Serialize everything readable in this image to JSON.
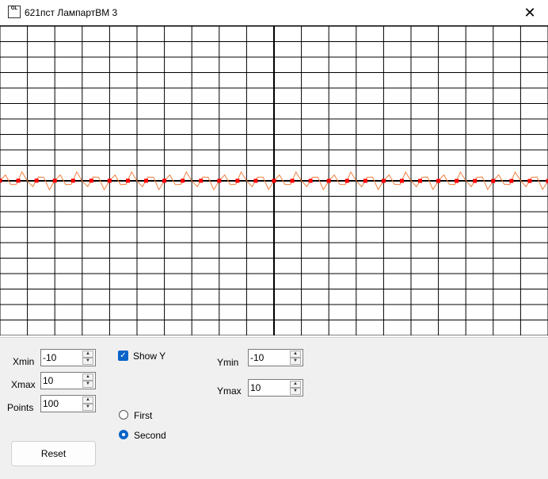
{
  "window": {
    "title": "621пст ЛампартВМ 3",
    "app_icon_text": "GL",
    "close_icon": "close-icon"
  },
  "controls": {
    "xmin_label": "Xmin",
    "xmin_value": "-10",
    "xmax_label": "Xmax",
    "xmax_value": "10",
    "points_label": "Points",
    "points_value": "100",
    "show_y_label": "Show Y",
    "show_y_checked": true,
    "ymin_label": "Ymin",
    "ymin_value": "-10",
    "ymax_label": "Ymax",
    "ymax_value": "10",
    "radio_first_label": "First",
    "radio_second_label": "Second",
    "selected_radio": "Second",
    "reset_label": "Reset"
  },
  "colors": {
    "grid": "#000000",
    "curve": "#f08040",
    "points": "#ff0000"
  },
  "chart_data": {
    "type": "line",
    "xlim": [
      -10,
      10
    ],
    "ylim": [
      -10,
      10
    ],
    "grid": true,
    "points_count": 100
  }
}
